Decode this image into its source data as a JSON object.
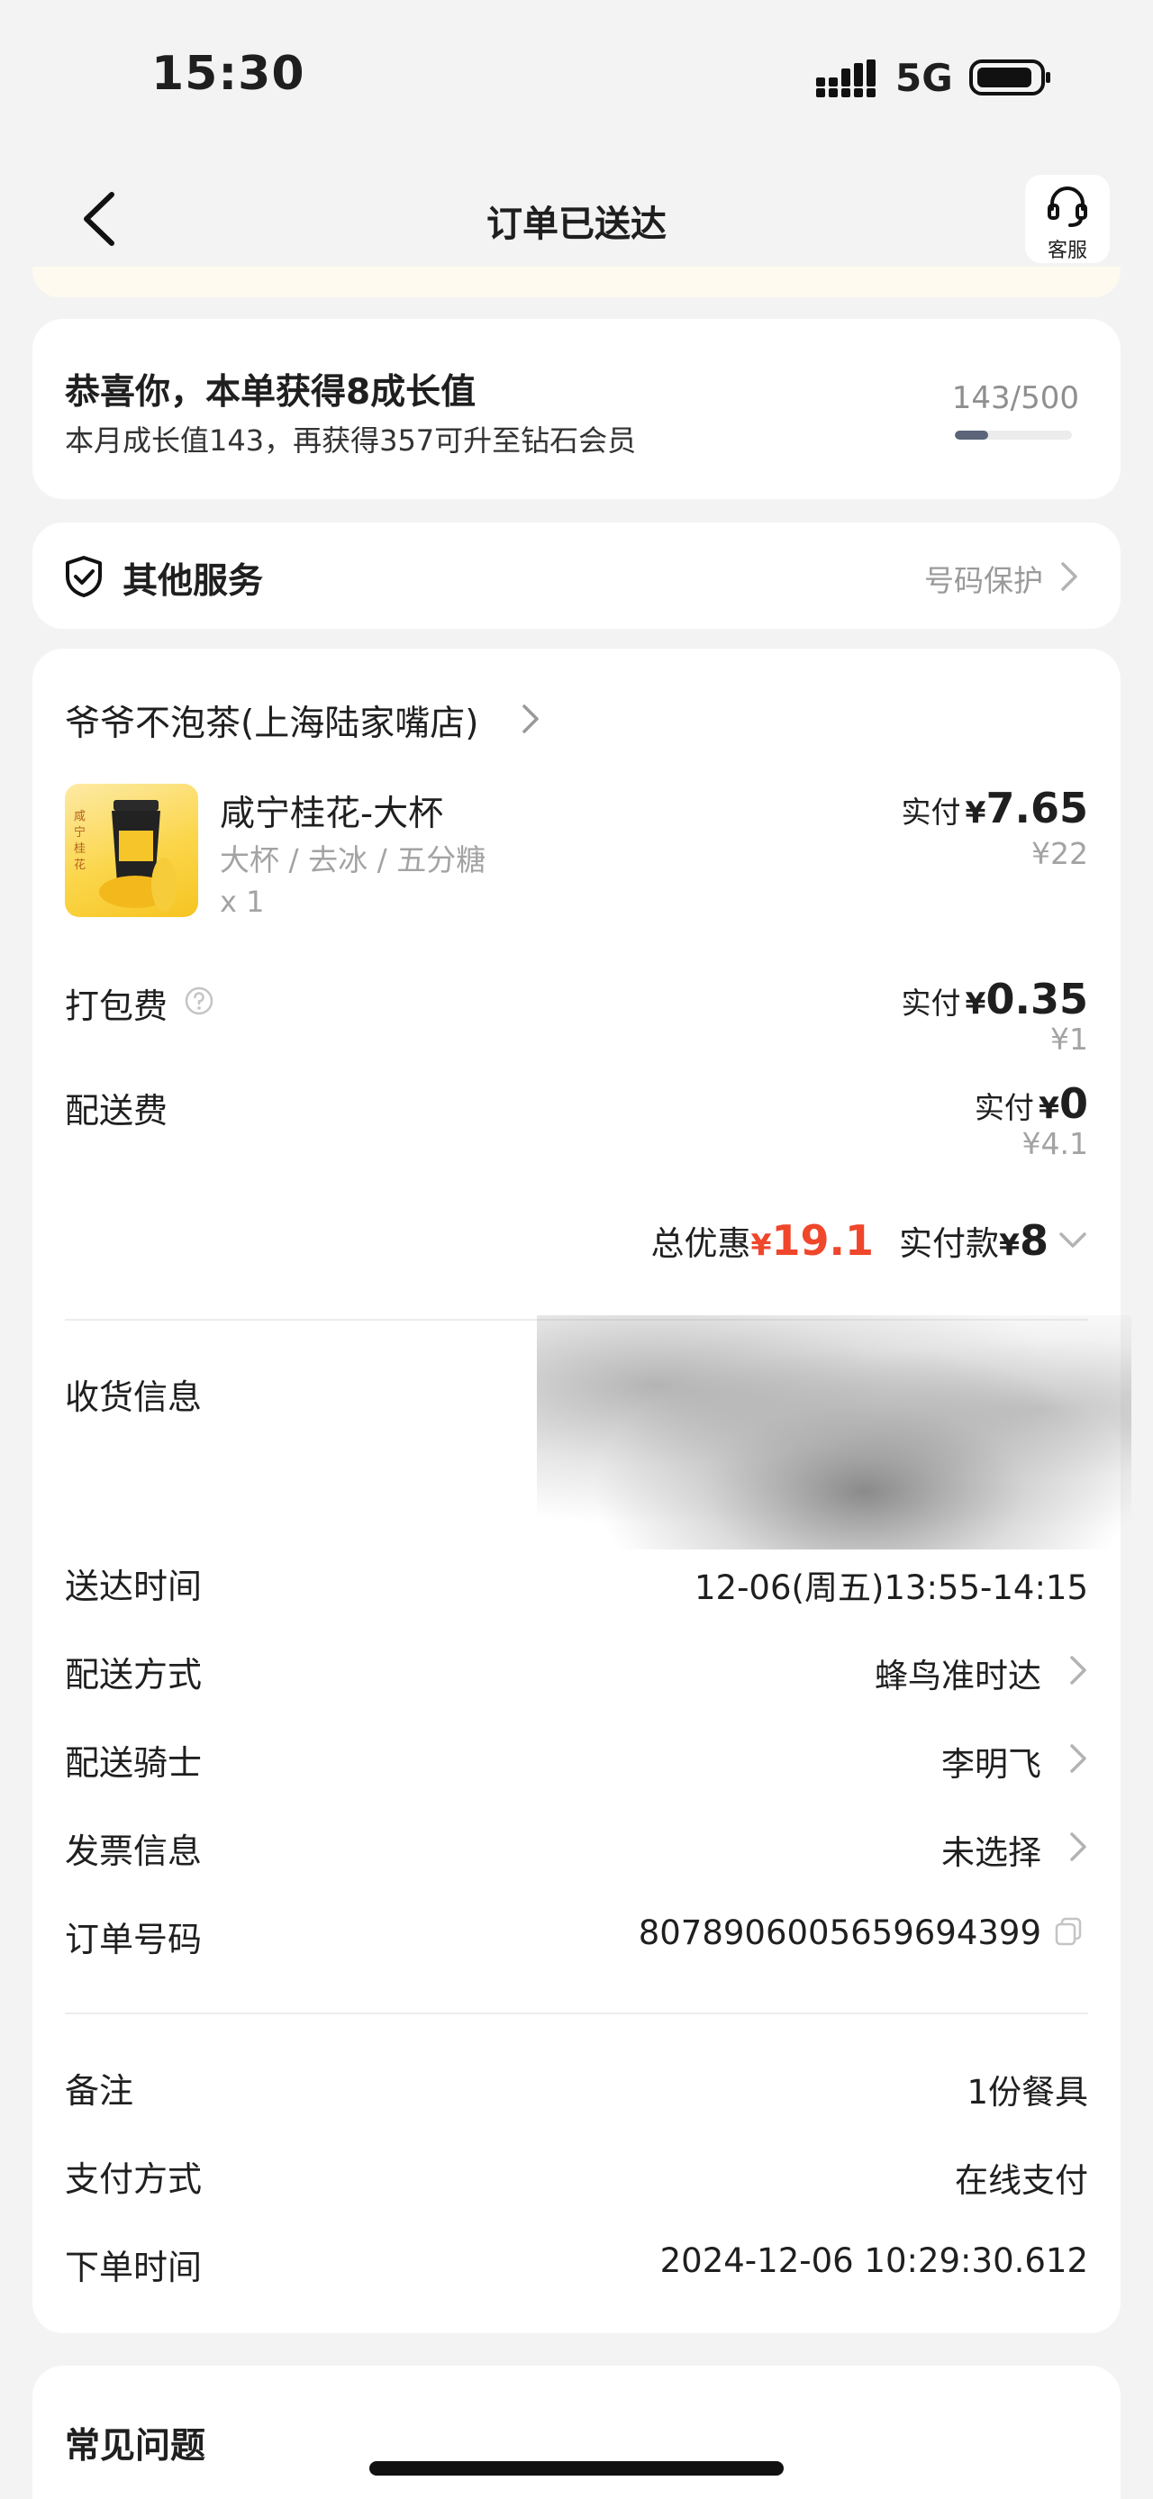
{
  "status_bar": {
    "time": "15:30",
    "network": "5G"
  },
  "header": {
    "title": "订单已送达",
    "service_label": "客服"
  },
  "growth": {
    "title": "恭喜你，本单获得8成长值",
    "subtitle": "本月成长值143，再获得357可升至钻石会员",
    "progress_text": "143/500",
    "progress_fraction": 0.286
  },
  "services": {
    "title": "其他服务",
    "link": "号码保护"
  },
  "order": {
    "shop_name": "爷爷不泡茶(上海陆家嘴店)",
    "item": {
      "name": "咸宁桂花-大杯",
      "spec": "大杯 / 去冰 / 五分糖",
      "qty": "x 1",
      "paid_label": "实付",
      "yen": "¥",
      "paid": "7.65",
      "original": "¥22"
    },
    "packing": {
      "label": "打包费",
      "paid_label": "实付",
      "yen": "¥",
      "paid": "0.35",
      "original": "¥1"
    },
    "delivery_fee": {
      "label": "配送费",
      "paid_label": "实付",
      "yen": "¥",
      "paid": "0",
      "original": "¥4.1"
    },
    "totals": {
      "discount_label": "总优惠",
      "discount_yen": "¥",
      "discount": "19.1",
      "paid_label": "实付款",
      "paid_yen": "¥",
      "paid": "8"
    },
    "info": [
      {
        "label": "收货信息",
        "value": ""
      },
      {
        "label": "送达时间",
        "value": "12-06(周五)13:55-14:15"
      },
      {
        "label": "配送方式",
        "value": "蜂鸟准时达"
      },
      {
        "label": "配送骑士",
        "value": "李明飞"
      },
      {
        "label": "发票信息",
        "value": "未选择"
      },
      {
        "label": "订单号码",
        "value": "8078906005659694399"
      }
    ],
    "extra": [
      {
        "label": "备注",
        "value": "1份餐具"
      },
      {
        "label": "支付方式",
        "value": "在线支付"
      },
      {
        "label": "下单时间",
        "value": "2024-12-06 10:29:30.612"
      }
    ]
  },
  "faq": {
    "title": "常见问题"
  },
  "colors": {
    "accent_red": "#f0462b",
    "progress": "#5b6478",
    "muted": "#a3a3a3"
  }
}
